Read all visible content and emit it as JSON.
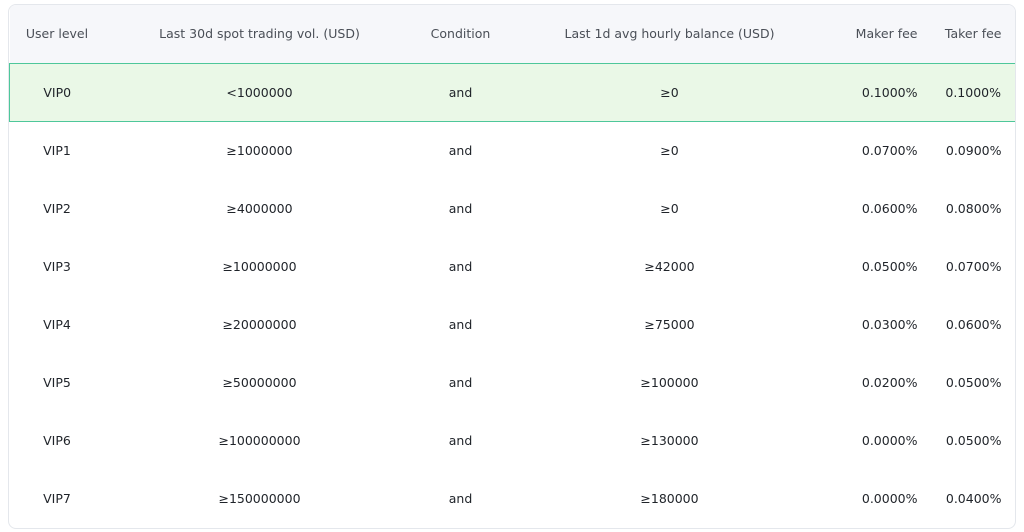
{
  "table": {
    "headers": {
      "level": "User level",
      "volume": "Last 30d spot trading vol. (USD)",
      "condition": "Condition",
      "balance": "Last 1d avg hourly balance (USD)",
      "maker": "Maker fee",
      "taker": "Taker fee"
    },
    "highlight_color": "#4ec79a",
    "rows": [
      {
        "level": "VIP0",
        "volume": "<1000000",
        "condition": "and",
        "balance": "≥0",
        "maker": "0.1000%",
        "taker": "0.1000%"
      },
      {
        "level": "VIP1",
        "volume": "≥1000000",
        "condition": "and",
        "balance": "≥0",
        "maker": "0.0700%",
        "taker": "0.0900%"
      },
      {
        "level": "VIP2",
        "volume": "≥4000000",
        "condition": "and",
        "balance": "≥0",
        "maker": "0.0600%",
        "taker": "0.0800%"
      },
      {
        "level": "VIP3",
        "volume": "≥10000000",
        "condition": "and",
        "balance": "≥42000",
        "maker": "0.0500%",
        "taker": "0.0700%"
      },
      {
        "level": "VIP4",
        "volume": "≥20000000",
        "condition": "and",
        "balance": "≥75000",
        "maker": "0.0300%",
        "taker": "0.0600%"
      },
      {
        "level": "VIP5",
        "volume": "≥50000000",
        "condition": "and",
        "balance": "≥100000",
        "maker": "0.0200%",
        "taker": "0.0500%"
      },
      {
        "level": "VIP6",
        "volume": "≥100000000",
        "condition": "and",
        "balance": "≥130000",
        "maker": "0.0000%",
        "taker": "0.0500%"
      },
      {
        "level": "VIP7",
        "volume": "≥150000000",
        "condition": "and",
        "balance": "≥180000",
        "maker": "0.0000%",
        "taker": "0.0400%"
      }
    ]
  }
}
